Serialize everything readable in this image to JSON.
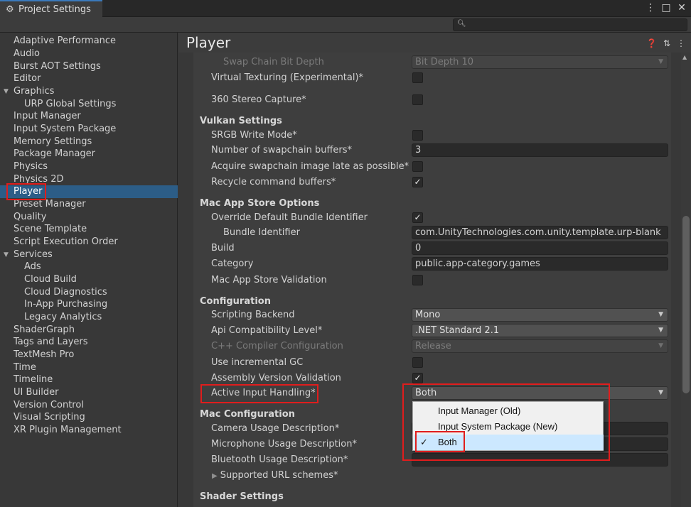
{
  "window": {
    "tab_title": "Project Settings",
    "tab_icon": "gear-icon",
    "buttons": [
      "⋮",
      "□",
      "✕"
    ]
  },
  "search": {
    "placeholder": "",
    "icon": "search-icon"
  },
  "sidebar": {
    "items": [
      {
        "label": "Adaptive Performance"
      },
      {
        "label": "Audio"
      },
      {
        "label": "Burst AOT Settings"
      },
      {
        "label": "Editor"
      },
      {
        "label": "Graphics"
      },
      {
        "label": "URP Global Settings"
      },
      {
        "label": "Input Manager"
      },
      {
        "label": "Input System Package"
      },
      {
        "label": "Memory Settings"
      },
      {
        "label": "Package Manager"
      },
      {
        "label": "Physics"
      },
      {
        "label": "Physics 2D"
      },
      {
        "label": "Player"
      },
      {
        "label": "Preset Manager"
      },
      {
        "label": "Quality"
      },
      {
        "label": "Scene Template"
      },
      {
        "label": "Script Execution Order"
      },
      {
        "label": "Services"
      },
      {
        "label": "Ads"
      },
      {
        "label": "Cloud Build"
      },
      {
        "label": "Cloud Diagnostics"
      },
      {
        "label": "In-App Purchasing"
      },
      {
        "label": "Legacy Analytics"
      },
      {
        "label": "ShaderGraph"
      },
      {
        "label": "Tags and Layers"
      },
      {
        "label": "TextMesh Pro"
      },
      {
        "label": "Time"
      },
      {
        "label": "Timeline"
      },
      {
        "label": "UI Builder"
      },
      {
        "label": "Version Control"
      },
      {
        "label": "Visual Scripting"
      },
      {
        "label": "XR Plugin Management"
      }
    ],
    "selected": "Player"
  },
  "main": {
    "title": "Player",
    "header_icons": [
      "help-icon",
      "preset-icon",
      "menu-icon"
    ]
  },
  "settings": {
    "swap_chain_bit_depth": {
      "label": "Swap Chain Bit Depth",
      "value": "Bit Depth 10"
    },
    "virtual_texturing": {
      "label": "Virtual Texturing (Experimental)*",
      "checked": false
    },
    "stereo_capture": {
      "label": "360 Stereo Capture*",
      "checked": false
    },
    "vulkan_header": "Vulkan Settings",
    "srgb_write": {
      "label": "SRGB Write Mode*",
      "checked": false
    },
    "swapchain_buffers": {
      "label": "Number of swapchain buffers*",
      "value": "3"
    },
    "acquire_late": {
      "label": "Acquire swapchain image late as possible*",
      "checked": false
    },
    "recycle_buffers": {
      "label": "Recycle command buffers*",
      "checked": true
    },
    "mac_store_header": "Mac App Store Options",
    "override_bundle": {
      "label": "Override Default Bundle Identifier",
      "checked": true
    },
    "bundle_id": {
      "label": "Bundle Identifier",
      "value": "com.UnityTechnologies.com.unity.template.urp-blank"
    },
    "build": {
      "label": "Build",
      "value": "0"
    },
    "category": {
      "label": "Category",
      "value": "public.app-category.games"
    },
    "store_validation": {
      "label": "Mac App Store Validation",
      "checked": false
    },
    "config_header": "Configuration",
    "scripting_backend": {
      "label": "Scripting Backend",
      "value": "Mono"
    },
    "api_level": {
      "label": "Api Compatibility Level*",
      "value": ".NET Standard 2.1"
    },
    "cpp_config": {
      "label": "C++ Compiler Configuration",
      "value": "Release"
    },
    "incremental_gc": {
      "label": "Use incremental GC",
      "checked": false
    },
    "assembly_validation": {
      "label": "Assembly Version Validation",
      "checked": true
    },
    "active_input": {
      "label": "Active Input Handling*",
      "value": "Both"
    },
    "mac_config_header": "Mac Configuration",
    "camera_usage": {
      "label": "Camera Usage Description*"
    },
    "microphone_usage": {
      "label": "Microphone Usage Description*"
    },
    "bluetooth_usage": {
      "label": "Bluetooth Usage Description*"
    },
    "url_schemes": {
      "label": "Supported URL schemes*"
    },
    "shader_header": "Shader Settings"
  },
  "dropdown_popup": {
    "options": [
      "Input Manager (Old)",
      "Input System Package (New)",
      "Both"
    ],
    "selected": "Both",
    "check_glyph": "✓"
  },
  "annotation_color": "#e01d1d",
  "selection_color": "#2c5d87"
}
